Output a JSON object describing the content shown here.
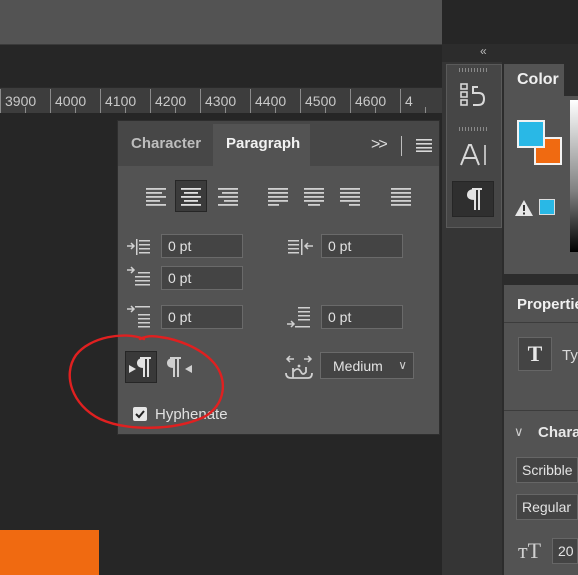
{
  "ruler": {
    "labels": [
      "3900",
      "4000",
      "4100",
      "4200",
      "4300",
      "4400",
      "4500",
      "4600",
      "4"
    ]
  },
  "dock": {
    "collapse_icon": "«",
    "tools": [
      "history-icon",
      "character-icon",
      "paragraph-icon"
    ]
  },
  "paragraph_panel": {
    "tabs": {
      "character": "Character",
      "paragraph": "Paragraph",
      "more": ">>"
    },
    "alignment": {
      "buttons": [
        "align-left",
        "align-center",
        "align-right",
        "justify-last-left",
        "justify-last-center",
        "justify-last-right",
        "justify-all"
      ],
      "selected": "align-center"
    },
    "indents": {
      "left_indent": "0 pt",
      "right_indent": "0 pt",
      "first_line_indent": "0 pt",
      "space_before": "0 pt",
      "space_after": "0 pt"
    },
    "direction": {
      "selected": "left-to-right"
    },
    "kashida": {
      "value": "Medium"
    },
    "hyphenate": {
      "label": "Hyphenate",
      "checked": true
    }
  },
  "color_panel": {
    "title": "Color",
    "foreground": "#29b8e6",
    "background": "#f06a11"
  },
  "properties_panel": {
    "title": "Properties",
    "layer_type_label": "Ty",
    "character_section": "Chara",
    "font_family": "Scribble I",
    "font_style": "Regular",
    "font_size": "20"
  },
  "annotation": {
    "color": "#e02020"
  }
}
